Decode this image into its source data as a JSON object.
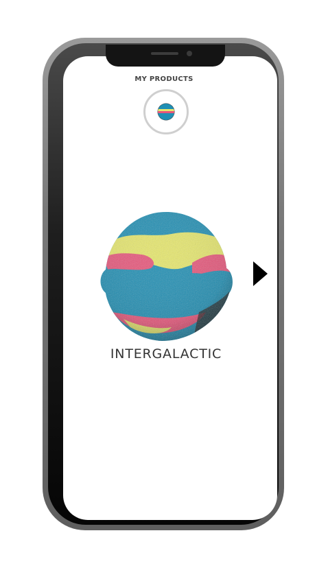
{
  "header": {
    "title": "MY PRODUCTS"
  },
  "product": {
    "name": "INTERGALACTIC",
    "colors": {
      "blue": "#1f8fb4",
      "yellow": "#e7e86c",
      "pink": "#e8557a"
    }
  },
  "navigation": {
    "next_icon": "triangle-right-icon"
  },
  "device": {
    "frame": "smartphone-mockup"
  }
}
